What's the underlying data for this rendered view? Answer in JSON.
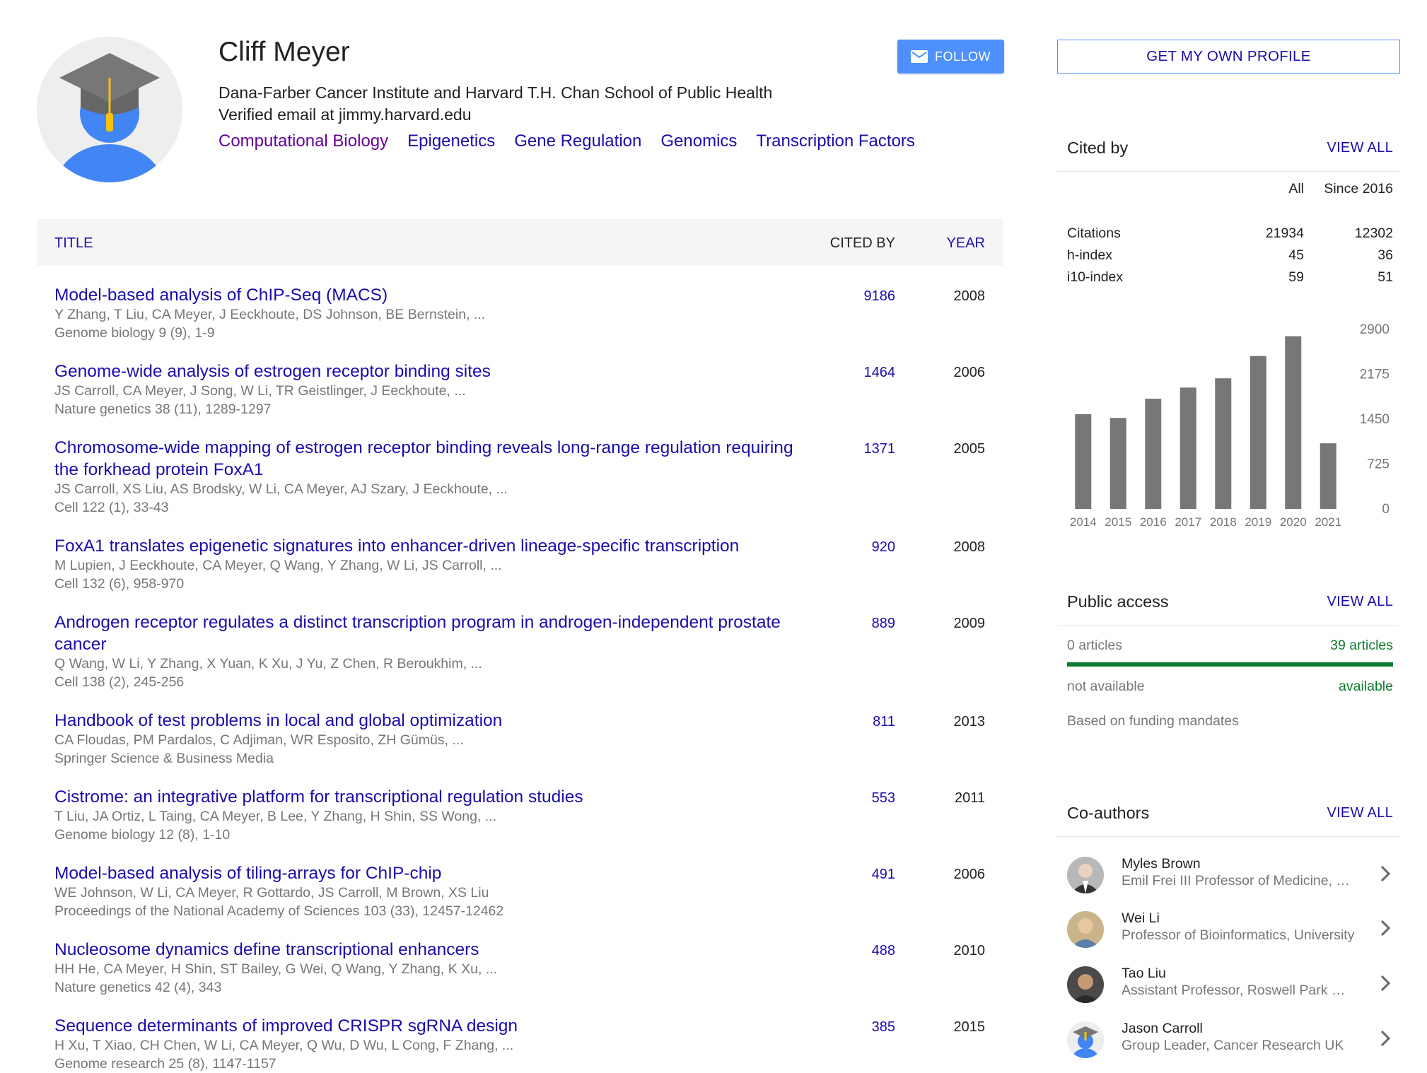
{
  "profile": {
    "name": "Cliff Meyer",
    "affiliation": "Dana-Farber Cancer Institute and Harvard T.H. Chan School of Public Health",
    "email": "Verified email at jimmy.harvard.edu",
    "interests": [
      "Computational Biology",
      "Epigenetics",
      "Gene Regulation",
      "Genomics",
      "Transcription Factors"
    ],
    "follow_label": "FOLLOW",
    "follow_icon": "envelope-icon",
    "avatar_icon": "graduation-cap-avatar"
  },
  "table": {
    "headers": {
      "title": "TITLE",
      "cited_by": "CITED BY",
      "year": "YEAR"
    },
    "rows": [
      {
        "title": "Model-based analysis of ChIP-Seq (MACS)",
        "authors": "Y Zhang, T Liu, CA Meyer, J Eeckhoute, DS Johnson, BE Bernstein, ...",
        "venue": "Genome biology 9 (9), 1-9",
        "cited_by": "9186",
        "year": "2008"
      },
      {
        "title": "Genome-wide analysis of estrogen receptor binding sites",
        "authors": "JS Carroll, CA Meyer, J Song, W Li, TR Geistlinger, J Eeckhoute, ...",
        "venue": "Nature genetics 38 (11), 1289-1297",
        "cited_by": "1464",
        "year": "2006"
      },
      {
        "title": "Chromosome-wide mapping of estrogen receptor binding reveals long-range regulation requiring the forkhead protein FoxA1",
        "authors": "JS Carroll, XS Liu, AS Brodsky, W Li, CA Meyer, AJ Szary, J Eeckhoute, ...",
        "venue": "Cell 122 (1), 33-43",
        "cited_by": "1371",
        "year": "2005"
      },
      {
        "title": "FoxA1 translates epigenetic signatures into enhancer-driven lineage-specific transcription",
        "authors": "M Lupien, J Eeckhoute, CA Meyer, Q Wang, Y Zhang, W Li, JS Carroll, ...",
        "venue": "Cell 132 (6), 958-970",
        "cited_by": "920",
        "year": "2008"
      },
      {
        "title": "Androgen receptor regulates a distinct transcription program in androgen-independent prostate cancer",
        "authors": "Q Wang, W Li, Y Zhang, X Yuan, K Xu, J Yu, Z Chen, R Beroukhim, ...",
        "venue": "Cell 138 (2), 245-256",
        "cited_by": "889",
        "year": "2009"
      },
      {
        "title": "Handbook of test problems in local and global optimization",
        "authors": "CA Floudas, PM Pardalos, C Adjiman, WR Esposito, ZH Gümüs, ...",
        "venue": "Springer Science & Business Media",
        "cited_by": "811",
        "year": "2013"
      },
      {
        "title": "Cistrome: an integrative platform for transcriptional regulation studies",
        "authors": "T Liu, JA Ortiz, L Taing, CA Meyer, B Lee, Y Zhang, H Shin, SS Wong, ...",
        "venue": "Genome biology 12 (8), 1-10",
        "cited_by": "553",
        "year": "2011"
      },
      {
        "title": "Model-based analysis of tiling-arrays for ChIP-chip",
        "authors": "WE Johnson, W Li, CA Meyer, R Gottardo, JS Carroll, M Brown, XS Liu",
        "venue": "Proceedings of the National Academy of Sciences 103 (33), 12457-12462",
        "cited_by": "491",
        "year": "2006"
      },
      {
        "title": "Nucleosome dynamics define transcriptional enhancers",
        "authors": "HH He, CA Meyer, H Shin, ST Bailey, G Wei, Q Wang, Y Zhang, K Xu, ...",
        "venue": "Nature genetics 42 (4), 343",
        "cited_by": "488",
        "year": "2010"
      },
      {
        "title": "Sequence determinants of improved CRISPR sgRNA design",
        "authors": "H Xu, T Xiao, CH Chen, W Li, CA Meyer, Q Wu, D Wu, L Cong, F Zhang, ...",
        "venue": "Genome research 25 (8), 1147-1157",
        "cited_by": "385",
        "year": "2015"
      }
    ]
  },
  "sidebar": {
    "get_profile_label": "GET MY OWN PROFILE",
    "cited_by": {
      "heading": "Cited by",
      "view_all": "VIEW ALL",
      "col_all": "All",
      "col_since": "Since 2016",
      "metrics": [
        {
          "label": "Citations",
          "all": "21934",
          "since": "12302"
        },
        {
          "label": "h-index",
          "all": "45",
          "since": "36"
        },
        {
          "label": "i10-index",
          "all": "59",
          "since": "51"
        }
      ]
    },
    "public_access": {
      "heading": "Public access",
      "view_all": "VIEW ALL",
      "left_count": "0 articles",
      "right_count": "39 articles",
      "left_status": "not available",
      "right_status": "available",
      "available_fraction": 1.0,
      "note": "Based on funding mandates"
    },
    "coauthors": {
      "heading": "Co-authors",
      "view_all": "VIEW ALL",
      "items": [
        {
          "name": "Myles Brown",
          "affiliation": "Emil Frei III Professor of Medicine, Dana-Farber Cancer Institute"
        },
        {
          "name": "Wei Li",
          "affiliation": "Professor of Bioinformatics, University"
        },
        {
          "name": "Tao Liu",
          "affiliation": "Assistant Professor, Roswell Park Comprehensive Cancer Center"
        },
        {
          "name": "Jason Carroll",
          "affiliation": "Group Leader, Cancer Research UK"
        }
      ]
    }
  },
  "chart_data": {
    "type": "bar",
    "categories": [
      "2014",
      "2015",
      "2016",
      "2017",
      "2018",
      "2019",
      "2020",
      "2021"
    ],
    "values": [
      1530,
      1470,
      1780,
      1960,
      2110,
      2470,
      2790,
      1060
    ],
    "yticks": [
      "2900",
      "2175",
      "1450",
      "725",
      "0"
    ],
    "ylim": [
      0,
      2900
    ],
    "bar_color": "#777777",
    "grid": false,
    "legend": "none"
  },
  "colors": {
    "link": "#1a0dab",
    "visited_link": "#660099",
    "button_blue": "#4d90fe",
    "available_green": "#0d7a2d",
    "muted_text": "#777777"
  }
}
